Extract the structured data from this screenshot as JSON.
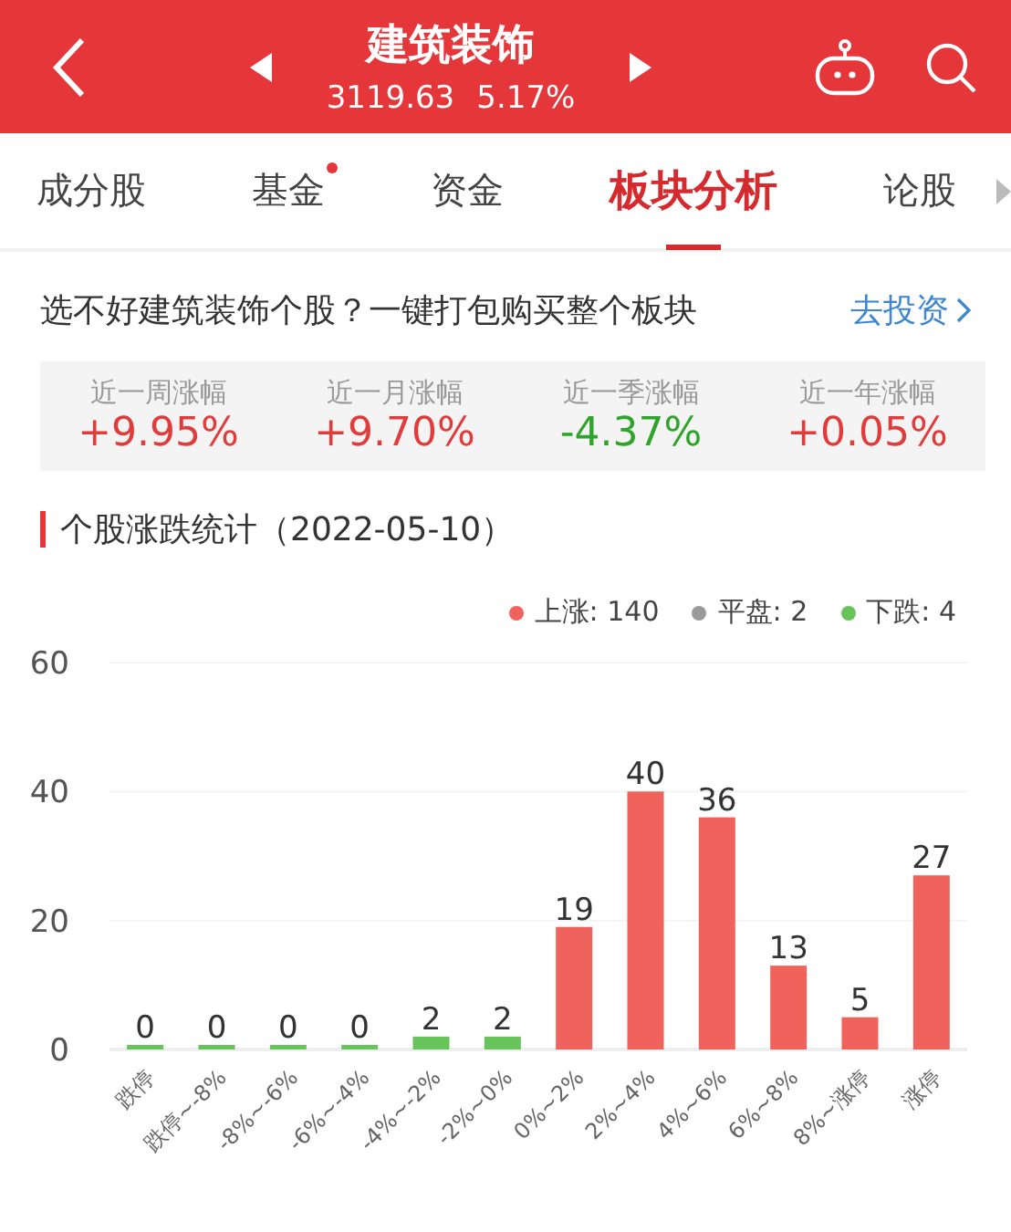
{
  "header": {
    "title": "建筑装饰",
    "index_value": "3119.63",
    "change": "5.17%"
  },
  "tabs": [
    {
      "label": "成分股",
      "selected": false,
      "badge": false
    },
    {
      "label": "基金",
      "selected": false,
      "badge": true
    },
    {
      "label": "资金",
      "selected": false,
      "badge": false
    },
    {
      "label": "板块分析",
      "selected": true,
      "badge": false
    },
    {
      "label": "论股",
      "selected": false,
      "badge": false
    }
  ],
  "promo": {
    "text": "选不好建筑装饰个股？一键打包购买整个板块",
    "link": "去投资"
  },
  "stats": [
    {
      "label": "近一周涨幅",
      "value": "+9.95%",
      "color": "#e03c3c"
    },
    {
      "label": "近一月涨幅",
      "value": "+9.70%",
      "color": "#e03c3c"
    },
    {
      "label": "近一季涨幅",
      "value": "-4.37%",
      "color": "#2ea52a"
    },
    {
      "label": "近一年涨幅",
      "value": "+0.05%",
      "color": "#e03c3c"
    }
  ],
  "section": {
    "title": "个股涨跌统计（2022-05-10）"
  },
  "legend": [
    {
      "label": "上涨: 140",
      "color": "#f0625c"
    },
    {
      "label": "平盘: 2",
      "color": "#9a9a9a"
    },
    {
      "label": "下跌: 4",
      "color": "#66c45a"
    }
  ],
  "chart_data": {
    "type": "bar",
    "categories": [
      "跌停",
      "跌停~-8%",
      "-8%~-6%",
      "-6%~-4%",
      "-4%~-2%",
      "-2%~0%",
      "0%~2%",
      "2%~4%",
      "4%~6%",
      "6%~8%",
      "8%~涨停",
      "涨停"
    ],
    "series": [
      {
        "color": "#66c45a",
        "values": [
          0,
          0,
          0,
          0,
          2,
          2,
          null,
          null,
          null,
          null,
          null,
          null
        ]
      },
      {
        "color": "#f0625c",
        "values": [
          null,
          null,
          null,
          null,
          null,
          null,
          19,
          40,
          36,
          13,
          5,
          27
        ]
      }
    ],
    "ylim": [
      0,
      60
    ],
    "yticks": [
      0,
      20,
      40,
      60
    ],
    "data_labels": true
  }
}
